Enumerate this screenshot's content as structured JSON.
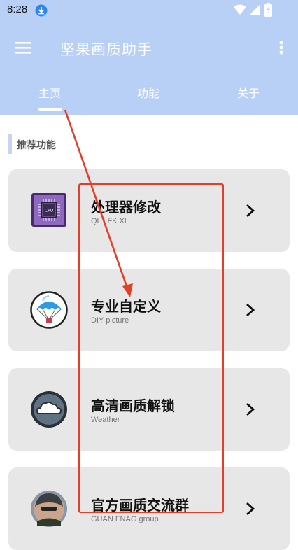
{
  "status_bar": {
    "time": "8:28",
    "icons": [
      "download-icon",
      "wifi-icon",
      "signal-icon",
      "battery-icon"
    ]
  },
  "app_bar": {
    "title": "坚果画质助手",
    "icons": [
      "menu-icon",
      "more-vert-icon"
    ]
  },
  "tabs": [
    {
      "label": "主页",
      "selected": true
    },
    {
      "label": "功能",
      "selected": false
    },
    {
      "label": "关于",
      "selected": false
    }
  ],
  "section": {
    "title": "推荐功能"
  },
  "cards": [
    {
      "title": "处理器修改",
      "subtitle": "QL LFK XL",
      "icon": "cpu-icon"
    },
    {
      "title": "专业自定义",
      "subtitle": "DIY picture",
      "icon": "parachute-icon"
    },
    {
      "title": "高清画质解锁",
      "subtitle": "Weather",
      "icon": "cloud-icon"
    },
    {
      "title": "官方画质交流群",
      "subtitle": "GUAN FNAG group",
      "icon": "soldier-avatar-icon"
    }
  ],
  "colors": {
    "header_bg": "#b8cff6",
    "card_bg": "#e7e7e7",
    "annotation_red": "#e0402a"
  }
}
